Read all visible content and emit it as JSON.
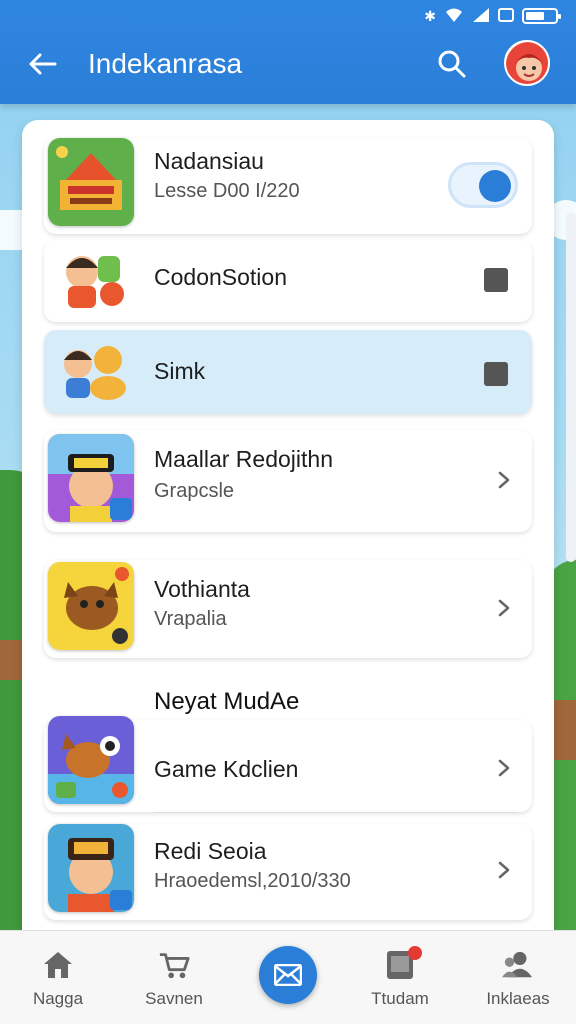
{
  "app": {
    "title": "Indekanrasa"
  },
  "header": {
    "back_icon": "arrow-left-icon",
    "search_icon": "search-icon",
    "avatar_icon": "user-avatar"
  },
  "colors": {
    "primary": "#2a7ed8",
    "active_row": "#d6ecf8",
    "badge": "#e53935"
  },
  "items": [
    {
      "title": "Nadansiau",
      "subtitle": "Lesse D00 I/220",
      "control": "toggle",
      "toggle_on": true
    },
    {
      "title": "CodonSotion",
      "control": "checkbox"
    },
    {
      "title": "Simk",
      "control": "checkbox",
      "active": true
    },
    {
      "title": "Maallar Redojithn",
      "subtitle": "Grapcsle",
      "control": "chevron"
    },
    {
      "title": "Vothianta",
      "subtitle": "Vrapalia",
      "control": "chevron"
    }
  ],
  "section": {
    "title": "Neyat MudAe",
    "items": [
      {
        "title": "Game Kdclien",
        "control": "chevron"
      },
      {
        "title": "Redi Seoia",
        "subtitle": "Hraoedemsl,2010/330",
        "control": "chevron"
      }
    ]
  },
  "bottom_nav": [
    {
      "label": "Nagga",
      "icon": "home-icon"
    },
    {
      "label": "Savnen",
      "icon": "cart-icon"
    },
    {
      "label": "",
      "icon": "mail-icon"
    },
    {
      "label": "Ttudam",
      "icon": "tablet-icon"
    },
    {
      "label": "Inklaeas",
      "icon": "people-icon"
    }
  ]
}
